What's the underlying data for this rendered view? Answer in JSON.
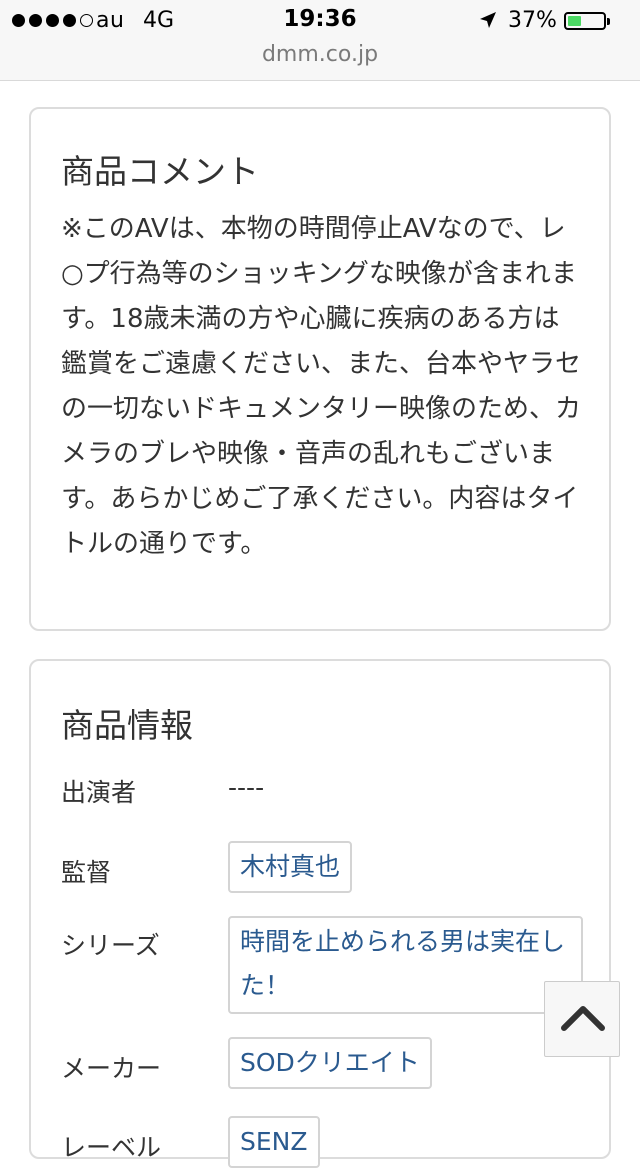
{
  "status_bar": {
    "carrier": "au",
    "network": "4G",
    "time": "19:36",
    "battery_percent": "37%",
    "battery_level": 0.37,
    "signal_bars_filled": 4,
    "signal_bars_total": 5,
    "location_icon": "location-arrow-icon",
    "battery_color": "#4cd964"
  },
  "browser": {
    "url": "dmm.co.jp"
  },
  "comment_section": {
    "title": "商品コメント",
    "body": "※このAVは、本物の時間停止AVなので、レ○プ行為等のショッキングな映像が含まれます。18歳未満の方や心臓に疾病のある方は鑑賞をご遠慮ください、また、台本やヤラセの一切ないドキュメンタリー映像のため、カメラのブレや映像・音声の乱れもございます。あらかじめご了承ください。内容はタイトルの通りです。"
  },
  "info_section": {
    "title": "商品情報",
    "rows": [
      {
        "label": "出演者",
        "value": "----"
      },
      {
        "label": "監督",
        "value": "木村真也"
      },
      {
        "label": "シリーズ",
        "value": "時間を止められる男は実在した！"
      },
      {
        "label": "メーカー",
        "value": "SODクリエイト"
      },
      {
        "label": "レーベル",
        "value": "SENZ"
      }
    ],
    "link_color": "#2a5a8f"
  },
  "scroll_top_button": {
    "icon": "chevron-up-icon"
  }
}
